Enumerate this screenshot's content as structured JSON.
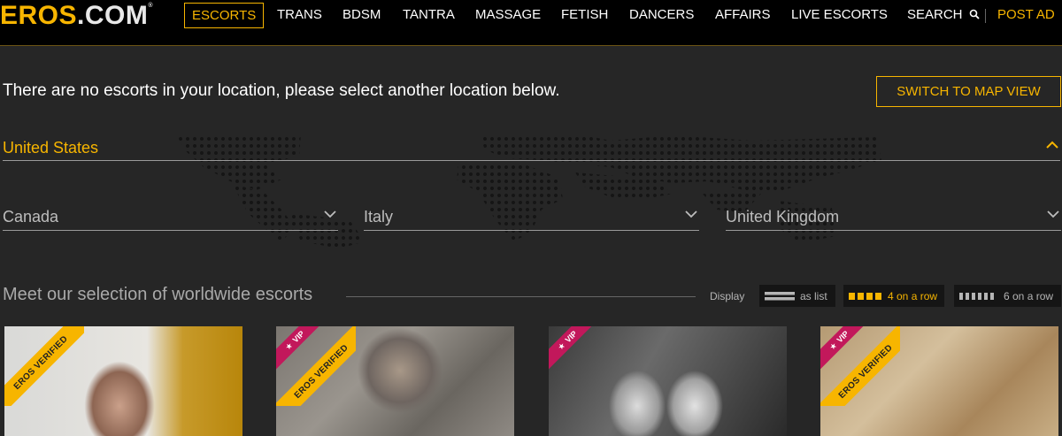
{
  "header": {
    "logo_brand": "EROS",
    "logo_tld": ".COM",
    "logo_mark": "®",
    "nav": [
      {
        "label": "ESCORTS",
        "active": true
      },
      {
        "label": "TRANS"
      },
      {
        "label": "BDSM"
      },
      {
        "label": "TANTRA"
      },
      {
        "label": "MASSAGE"
      },
      {
        "label": "FETISH"
      },
      {
        "label": "DANCERS"
      },
      {
        "label": "AFFAIRS"
      },
      {
        "label": "LIVE ESCORTS"
      },
      {
        "label": "SEARCH",
        "icon": "search-icon"
      }
    ],
    "post_ad": "POST AD"
  },
  "location": {
    "notice": "There are no escorts in your location, please select another location below.",
    "map_button": "SWITCH TO MAP VIEW",
    "country": "United States",
    "country_icon": "chevron-up-icon",
    "sub_countries": [
      {
        "label": "Canada",
        "icon": "chevron-down-icon"
      },
      {
        "label": "Italy",
        "icon": "chevron-down-icon"
      },
      {
        "label": "United Kingdom",
        "icon": "chevron-down-icon"
      }
    ]
  },
  "selection": {
    "title": "Meet our selection of worldwide escorts",
    "display_label": "Display",
    "options": [
      {
        "label": "as list",
        "active": false
      },
      {
        "label": "4 on a row",
        "active": true
      },
      {
        "label": "6 on a row",
        "active": false
      }
    ]
  },
  "cards": [
    {
      "badge": "EROS VERIFIED",
      "vip": false
    },
    {
      "badge": "EROS VERIFIED",
      "vip": true,
      "vip_label": "VIP"
    },
    {
      "badge": "",
      "vip": true,
      "vip_label": "VIP"
    },
    {
      "badge": "EROS VERIFIED",
      "vip": true,
      "vip_label": "VIP"
    }
  ],
  "colors": {
    "accent": "#f7b500",
    "background": "#262626",
    "header": "#000000",
    "vip": "#c2185b"
  }
}
